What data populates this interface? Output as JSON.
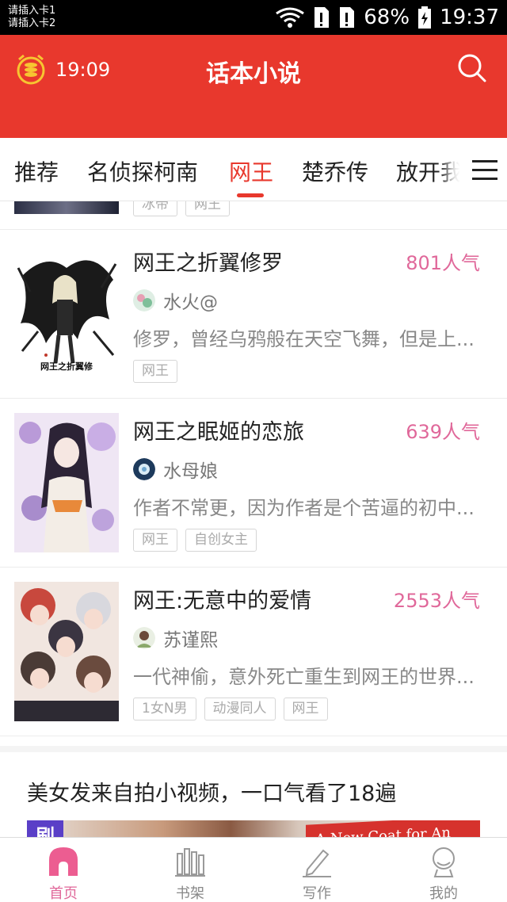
{
  "status_bar": {
    "sim1": "请插入卡1",
    "sim2": "请插入卡2",
    "battery": "68%",
    "time": "19:37"
  },
  "header": {
    "alarm_time": "19:09",
    "title": "话本小说"
  },
  "tabs": [
    {
      "label": "推荐"
    },
    {
      "label": "名侦探柯南"
    },
    {
      "label": "网王"
    },
    {
      "label": "楚乔传"
    },
    {
      "label": "放开我:"
    }
  ],
  "partial_item": {
    "tags": [
      "冰帝",
      "网王"
    ]
  },
  "books": [
    {
      "title": "网王之折翼修罗",
      "popularity": "801人气",
      "author": "水火@",
      "description": "修罗，曾经乌鸦般在天空飞舞，但是上...",
      "tags": [
        "网王"
      ],
      "cover_caption": "网王之折翼修"
    },
    {
      "title": "网王之眠姬的恋旅",
      "popularity": "639人气",
      "author": "水母娘",
      "description": "作者不常更，因为作者是个苦逼的初中...",
      "tags": [
        "网王",
        "自创女主"
      ]
    },
    {
      "title": "网王:无意中的爱情",
      "popularity": "2553人气",
      "author": "苏谨熙",
      "description": "一代神偷，意外死亡重生到网王的世界...",
      "tags": [
        "1女N男",
        "动漫同人",
        "网王"
      ]
    }
  ],
  "ad": {
    "title": "美女发来自拍小视频，一口气看了18遍",
    "badge": "刷",
    "sign_text": "A New Coat for An"
  },
  "bottom_nav": [
    {
      "label": "首页",
      "icon": "home-icon",
      "active": true
    },
    {
      "label": "书架",
      "icon": "bookshelf-icon",
      "active": false
    },
    {
      "label": "写作",
      "icon": "pen-icon",
      "active": false
    },
    {
      "label": "我的",
      "icon": "profile-icon",
      "active": false
    }
  ],
  "colors": {
    "brand_red": "#e8382d",
    "popularity_pink": "#e0689a"
  }
}
